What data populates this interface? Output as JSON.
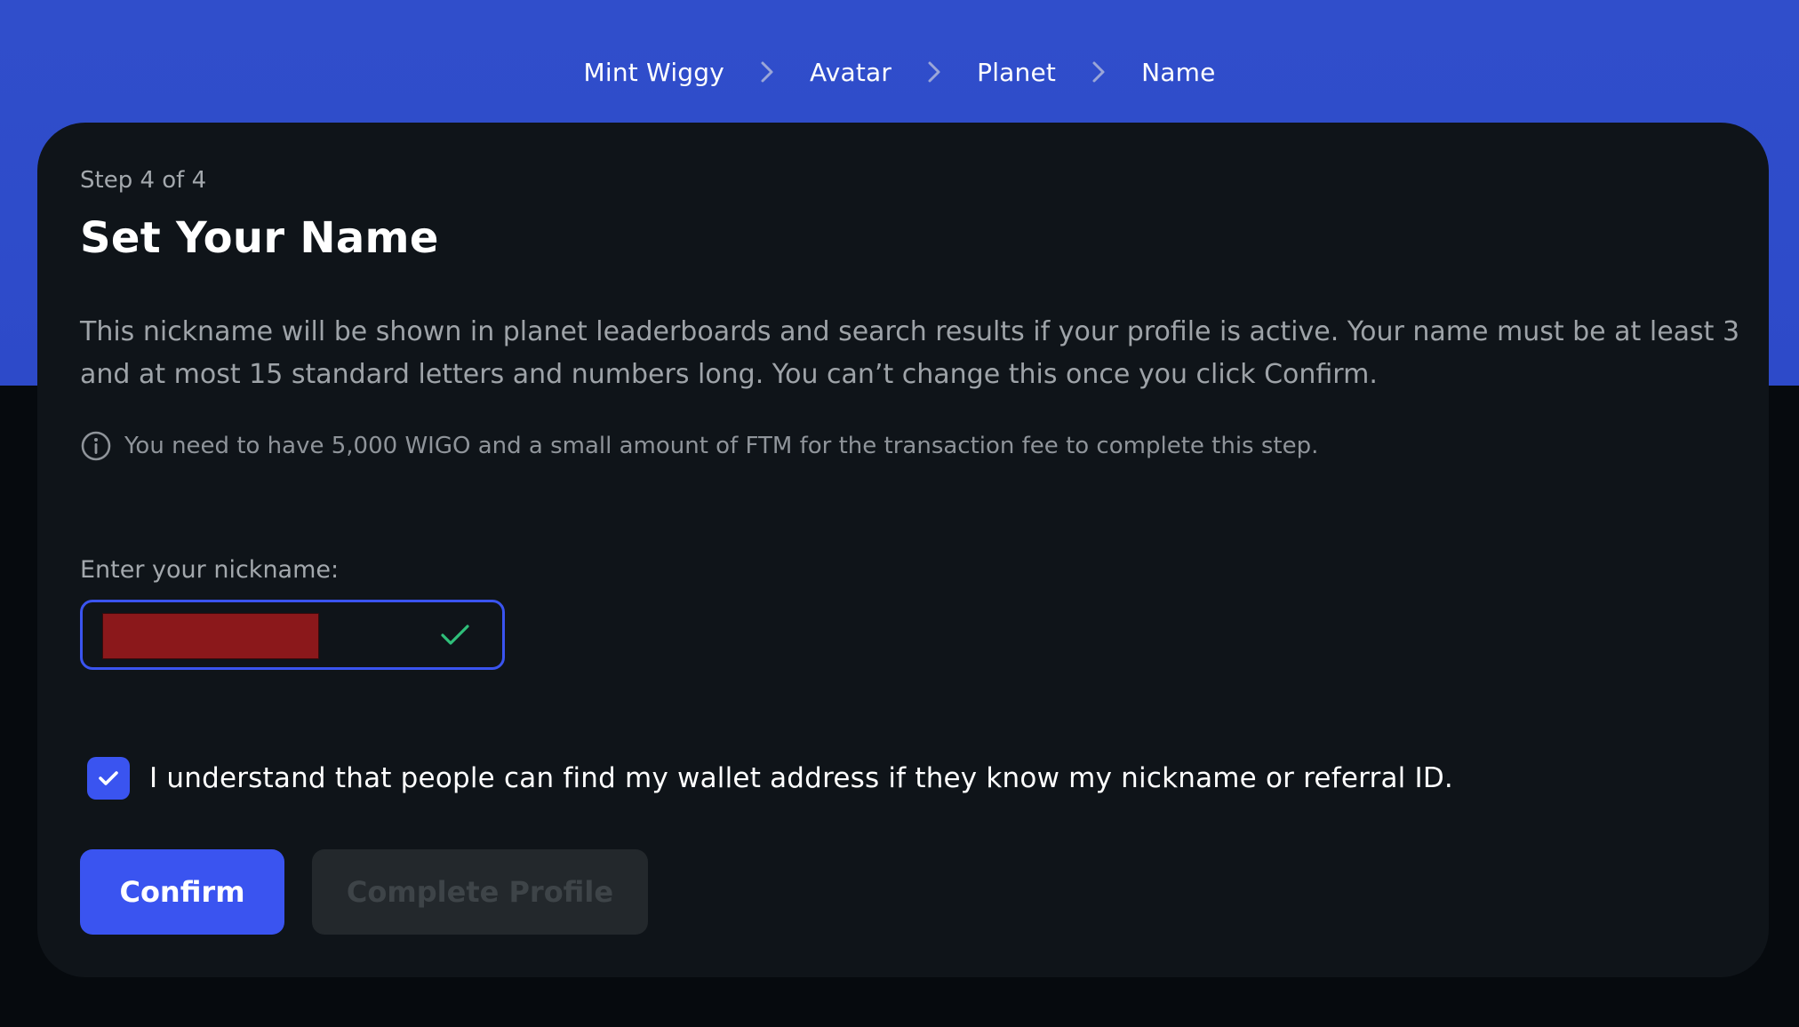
{
  "breadcrumb": {
    "items": [
      {
        "label": "Mint Wiggy"
      },
      {
        "label": "Avatar"
      },
      {
        "label": "Planet"
      },
      {
        "label": "Name"
      }
    ],
    "separator_icon": "chevron-right-icon"
  },
  "card": {
    "step": "Step 4 of 4",
    "title": "Set Your Name",
    "description": "This nickname will be shown in planet leaderboards and search results if your profile is active. Your name must be at least 3 and at most 15 standard letters and numbers long. You can’t change this once you click Confirm.",
    "notice": "You need to have 5,000 WIGO and a small amount of FTM for the transaction fee to complete this step.",
    "notice_icon": "info-icon"
  },
  "nickname": {
    "label": "Enter your nickname:",
    "value": "",
    "valid_icon": "check-icon",
    "redacted": true
  },
  "acknowledge": {
    "checked": true,
    "text": "I understand that people can find my wallet address if they know my nickname or referral ID."
  },
  "actions": {
    "confirm_label": "Confirm",
    "complete_label": "Complete Profile"
  },
  "colors": {
    "header_bg": "#304ecb",
    "page_bg": "#060a0e",
    "card_bg": "#0f1419",
    "accent": "#3a54f0",
    "valid": "#2fbf7a",
    "redaction": "#8b181b",
    "disabled_bg": "#23282c"
  }
}
